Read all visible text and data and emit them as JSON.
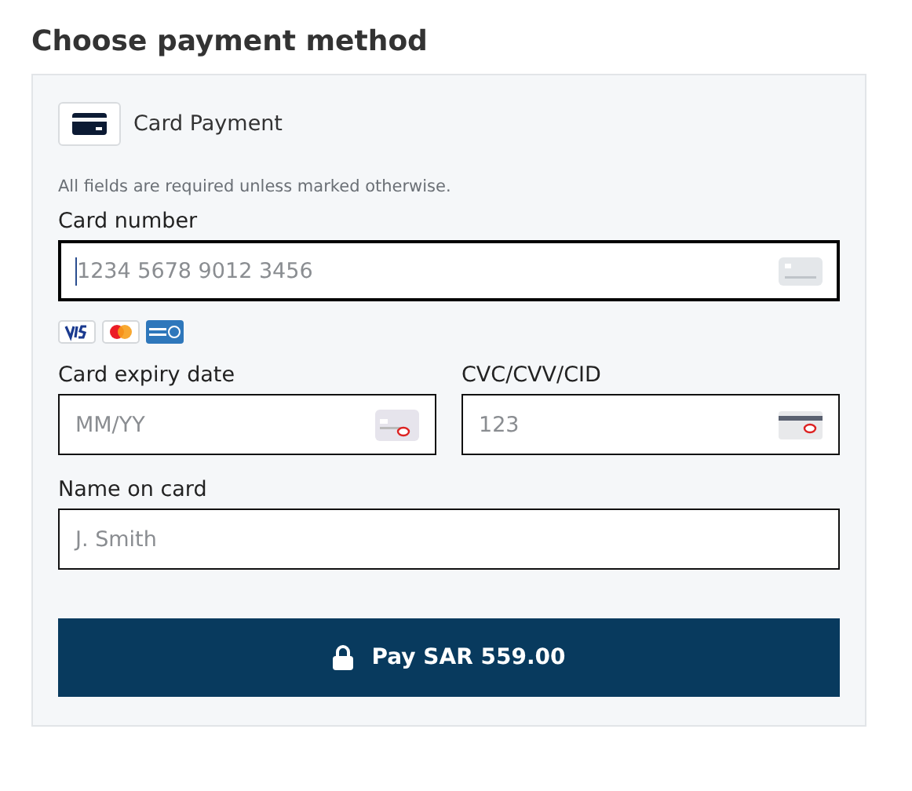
{
  "title": "Choose payment method",
  "method": {
    "label": "Card Payment"
  },
  "note": "All fields are required unless marked otherwise.",
  "fields": [
    {
      "label": "Card number",
      "placeholder": "1234 5678 9012 3456",
      "kind": "number",
      "focused": true
    },
    {
      "label": "Card expiry date",
      "placeholder": "MM/YY",
      "kind": "expiry",
      "focused": false
    },
    {
      "label": "CVC/CVV/CID",
      "placeholder": "123",
      "kind": "cvc",
      "focused": false
    },
    {
      "label": "Name on card",
      "placeholder": "J. Smith",
      "kind": "name",
      "focused": false
    }
  ],
  "pay_button": {
    "label": "Pay SAR 559.00"
  }
}
